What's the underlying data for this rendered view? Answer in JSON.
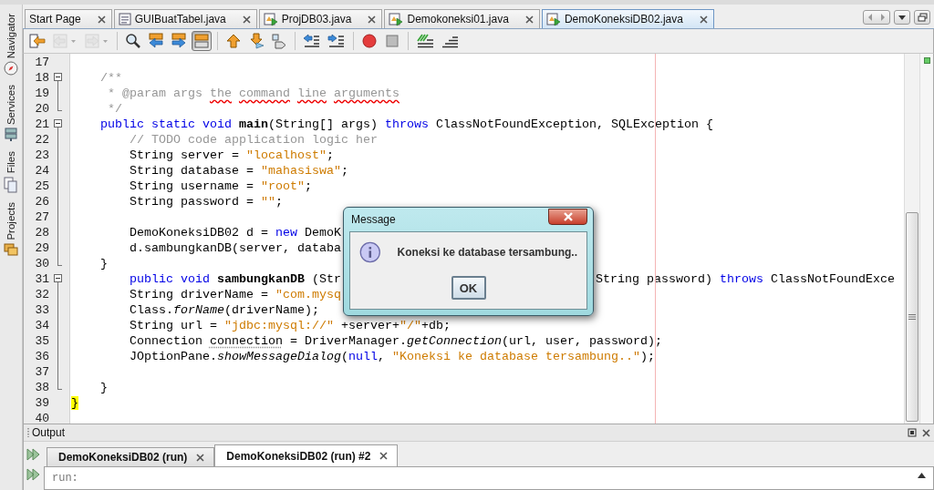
{
  "side_panel": [
    {
      "label": "Navigator",
      "kind": "compass"
    },
    {
      "label": "Services",
      "kind": "server"
    },
    {
      "label": "Files",
      "kind": "documents"
    },
    {
      "label": "Projects",
      "kind": "folders"
    }
  ],
  "editor_tabs": [
    {
      "label": "Start Page",
      "kind": "page",
      "selected": false
    },
    {
      "label": "GUIBuatTabel.java",
      "kind": "form",
      "selected": false
    },
    {
      "label": "ProjDB03.java",
      "kind": "runnable",
      "selected": false
    },
    {
      "label": "Demokoneksi01.java",
      "kind": "runnable",
      "selected": false
    },
    {
      "label": "DemoKoneksiDB02.java",
      "kind": "runnable",
      "selected": true
    }
  ],
  "toolbar": [
    {
      "kind": "last-edit",
      "disabled": false,
      "pressed": false
    },
    {
      "kind": "back",
      "disabled": true,
      "pressed": false
    },
    {
      "kind": "forward",
      "disabled": true,
      "pressed": false
    },
    {
      "kind": "separator"
    },
    {
      "kind": "search",
      "disabled": false,
      "pressed": false
    },
    {
      "kind": "find-previous",
      "disabled": false,
      "pressed": false
    },
    {
      "kind": "find-next",
      "disabled": false,
      "pressed": false
    },
    {
      "kind": "highlight",
      "disabled": false,
      "pressed": true
    },
    {
      "kind": "separator"
    },
    {
      "kind": "previous-bookmark",
      "disabled": false,
      "pressed": false
    },
    {
      "kind": "next-bookmark",
      "disabled": false,
      "pressed": false
    },
    {
      "kind": "toggle-bookmark",
      "disabled": false,
      "pressed": false
    },
    {
      "kind": "separator"
    },
    {
      "kind": "shift-left",
      "disabled": false,
      "pressed": false
    },
    {
      "kind": "shift-right",
      "disabled": false,
      "pressed": false
    },
    {
      "kind": "separator"
    },
    {
      "kind": "record",
      "disabled": false,
      "pressed": false
    },
    {
      "kind": "stop",
      "disabled": false,
      "pressed": false
    },
    {
      "kind": "separator"
    },
    {
      "kind": "comment",
      "disabled": false,
      "pressed": false
    },
    {
      "kind": "uncomment",
      "disabled": false,
      "pressed": false
    }
  ],
  "code": [
    {
      "number": "17",
      "kind": "plain"
    },
    {
      "number": "18",
      "kind": "fold-start",
      "tokens": [
        {
          "kind": "comment",
          "text": "    /**"
        }
      ]
    },
    {
      "number": "19",
      "kind": "fold-body",
      "tokens": [
        {
          "kind": "comment",
          "text": "     * @param args "
        },
        {
          "kind": "misspelled",
          "text": "the command line arguments"
        }
      ]
    },
    {
      "number": "20",
      "kind": "fold-end",
      "tokens": [
        {
          "kind": "comment",
          "text": "     */"
        }
      ]
    },
    {
      "number": "21",
      "kind": "fold-start",
      "tokens": [
        {
          "kind": "keyword",
          "text": "    public static void "
        },
        {
          "kind": "declaration",
          "text": "main"
        },
        {
          "kind": "plain",
          "text": "(String[] args) "
        },
        {
          "kind": "keyword",
          "text": "throws"
        },
        {
          "kind": "plain",
          "text": " ClassNotFoundException, SQLException {"
        }
      ]
    },
    {
      "number": "22",
      "kind": "fold-body",
      "tokens": [
        {
          "kind": "comment",
          "text": "        // TODO code application logic her"
        }
      ]
    },
    {
      "number": "23",
      "kind": "fold-body",
      "tokens": [
        {
          "kind": "plain",
          "text": "        String server = "
        },
        {
          "kind": "string",
          "text": "\"localhost\""
        },
        {
          "kind": "plain",
          "text": ";"
        }
      ]
    },
    {
      "number": "24",
      "kind": "fold-body",
      "tokens": [
        {
          "kind": "plain",
          "text": "        String database = "
        },
        {
          "kind": "string",
          "text": "\"mahasiswa\""
        },
        {
          "kind": "plain",
          "text": ";"
        }
      ]
    },
    {
      "number": "25",
      "kind": "fold-body",
      "tokens": [
        {
          "kind": "plain",
          "text": "        String username = "
        },
        {
          "kind": "string",
          "text": "\"root\""
        },
        {
          "kind": "plain",
          "text": ";"
        }
      ]
    },
    {
      "number": "26",
      "kind": "fold-body",
      "tokens": [
        {
          "kind": "plain",
          "text": "        String password = "
        },
        {
          "kind": "string",
          "text": "\"\""
        },
        {
          "kind": "plain",
          "text": ";"
        }
      ]
    },
    {
      "number": "27",
      "kind": "fold-body"
    },
    {
      "number": "28",
      "kind": "fold-body",
      "tokens": [
        {
          "kind": "plain",
          "text": "        DemoKoneksiDB02 d = "
        },
        {
          "kind": "keyword",
          "text": "new"
        },
        {
          "kind": "plain",
          "text": " DemoK"
        }
      ]
    },
    {
      "number": "29",
      "kind": "fold-body",
      "tokens": [
        {
          "kind": "plain",
          "text": "        d.sambungkanDB(server, databa"
        }
      ]
    },
    {
      "number": "30",
      "kind": "fold-end",
      "tokens": [
        {
          "kind": "plain",
          "text": "    }"
        }
      ]
    },
    {
      "number": "31",
      "kind": "fold-start",
      "tokens": [
        {
          "kind": "keyword",
          "text": "        public void "
        },
        {
          "kind": "declaration",
          "text": "sambungkanDB"
        },
        {
          "kind": "plain",
          "text": " (Str"
        }
      ],
      "after_dialog": [
        {
          "kind": "plain",
          "text": "String password) "
        },
        {
          "kind": "keyword",
          "text": "throws"
        },
        {
          "kind": "plain",
          "text": " ClassNotFoundExce"
        }
      ]
    },
    {
      "number": "32",
      "kind": "fold-body",
      "tokens": [
        {
          "kind": "plain",
          "text": "        String driverName = "
        },
        {
          "kind": "string",
          "text": "\"com.mysq"
        }
      ]
    },
    {
      "number": "33",
      "kind": "fold-body",
      "tokens": [
        {
          "kind": "plain",
          "text": "        Class."
        },
        {
          "kind": "static",
          "text": "forName"
        },
        {
          "kind": "plain",
          "text": "(driverName);"
        }
      ]
    },
    {
      "number": "34",
      "kind": "fold-body",
      "tokens": [
        {
          "kind": "plain",
          "text": "        String url = "
        },
        {
          "kind": "string",
          "text": "\"jdbc:mysql://\""
        },
        {
          "kind": "plain",
          "text": " +server+"
        },
        {
          "kind": "string",
          "text": "\"/\""
        },
        {
          "kind": "plain",
          "text": "+db;"
        }
      ]
    },
    {
      "number": "35",
      "kind": "fold-body",
      "tokens": [
        {
          "kind": "plain",
          "text": "        Connection "
        },
        {
          "kind": "unused",
          "text": "connection"
        },
        {
          "kind": "plain",
          "text": " = DriverManager."
        },
        {
          "kind": "static",
          "text": "getConnection"
        },
        {
          "kind": "plain",
          "text": "(url, user, password);"
        }
      ]
    },
    {
      "number": "36",
      "kind": "fold-body",
      "tokens": [
        {
          "kind": "plain",
          "text": "        JOptionPane."
        },
        {
          "kind": "static",
          "text": "showMessageDialog"
        },
        {
          "kind": "plain",
          "text": "("
        },
        {
          "kind": "keyword",
          "text": "null"
        },
        {
          "kind": "plain",
          "text": ", "
        },
        {
          "kind": "string",
          "text": "\"Koneksi ke database tersambung..\""
        },
        {
          "kind": "plain",
          "text": ");"
        }
      ]
    },
    {
      "number": "37",
      "kind": "fold-body"
    },
    {
      "number": "38",
      "kind": "fold-end",
      "tokens": [
        {
          "kind": "plain",
          "text": "    }"
        }
      ]
    },
    {
      "number": "39",
      "kind": "plain",
      "tokens": [
        {
          "kind": "match",
          "text": "}"
        }
      ]
    },
    {
      "number": "40",
      "kind": "plain"
    }
  ],
  "output": {
    "title": "Output",
    "tabs": [
      {
        "label": "DemoKoneksiDB02 (run)",
        "selected": false
      },
      {
        "label": "DemoKoneksiDB02 (run) #2",
        "selected": true
      }
    ],
    "text": "run:"
  },
  "dialog": {
    "title": "Message",
    "message": "Koneksi ke database tersambung..",
    "button": "OK"
  }
}
